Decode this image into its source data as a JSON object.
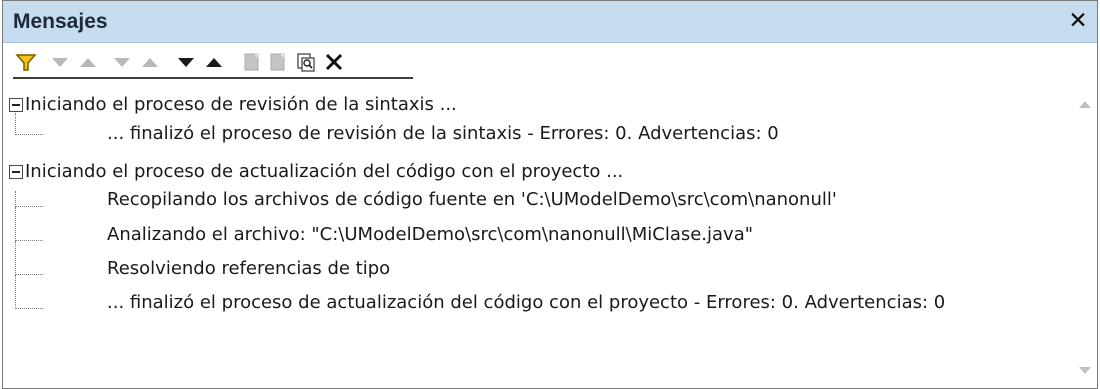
{
  "panel": {
    "title": "Mensajes",
    "close_label": "✕"
  },
  "toolbar": {
    "buttons": [
      {
        "icon": "filter-icon"
      },
      {
        "icon": "next-error-icon"
      },
      {
        "icon": "previous-error-icon"
      },
      {
        "icon": "next-warning-icon"
      },
      {
        "icon": "previous-warning-icon"
      },
      {
        "icon": "next-message-icon"
      },
      {
        "icon": "previous-message-icon"
      },
      {
        "icon": "copy-selected-icon"
      },
      {
        "icon": "copy-all-icon"
      },
      {
        "icon": "find-icon"
      },
      {
        "icon": "clear-icon"
      }
    ]
  },
  "messages": {
    "groups": [
      {
        "header": "Iniciando el proceso de revisión de la sintaxis ...",
        "children": [
          "... finalizó el proceso de revisión de la sintaxis - Errores: 0. Advertencias: 0"
        ]
      },
      {
        "header": "Iniciando el proceso de actualización del código con el proyecto ...",
        "children": [
          "Recopilando los archivos de código fuente en 'C:\\UModelDemo\\src\\com\\nanonull'",
          "Analizando el archivo: \"C:\\UModelDemo\\src\\com\\nanonull\\MiClase.java\"",
          "Resolviendo referencias de tipo",
          "... finalizó el proceso de actualización del código con el proyecto - Errores: 0. Advertencias: 0"
        ]
      }
    ]
  },
  "colors": {
    "titlebar": "#c8dcf0",
    "icon_disabled": "#b8b8b8",
    "icon_enabled": "#1a1a1a",
    "filter_yellow": "#f2c21b"
  }
}
